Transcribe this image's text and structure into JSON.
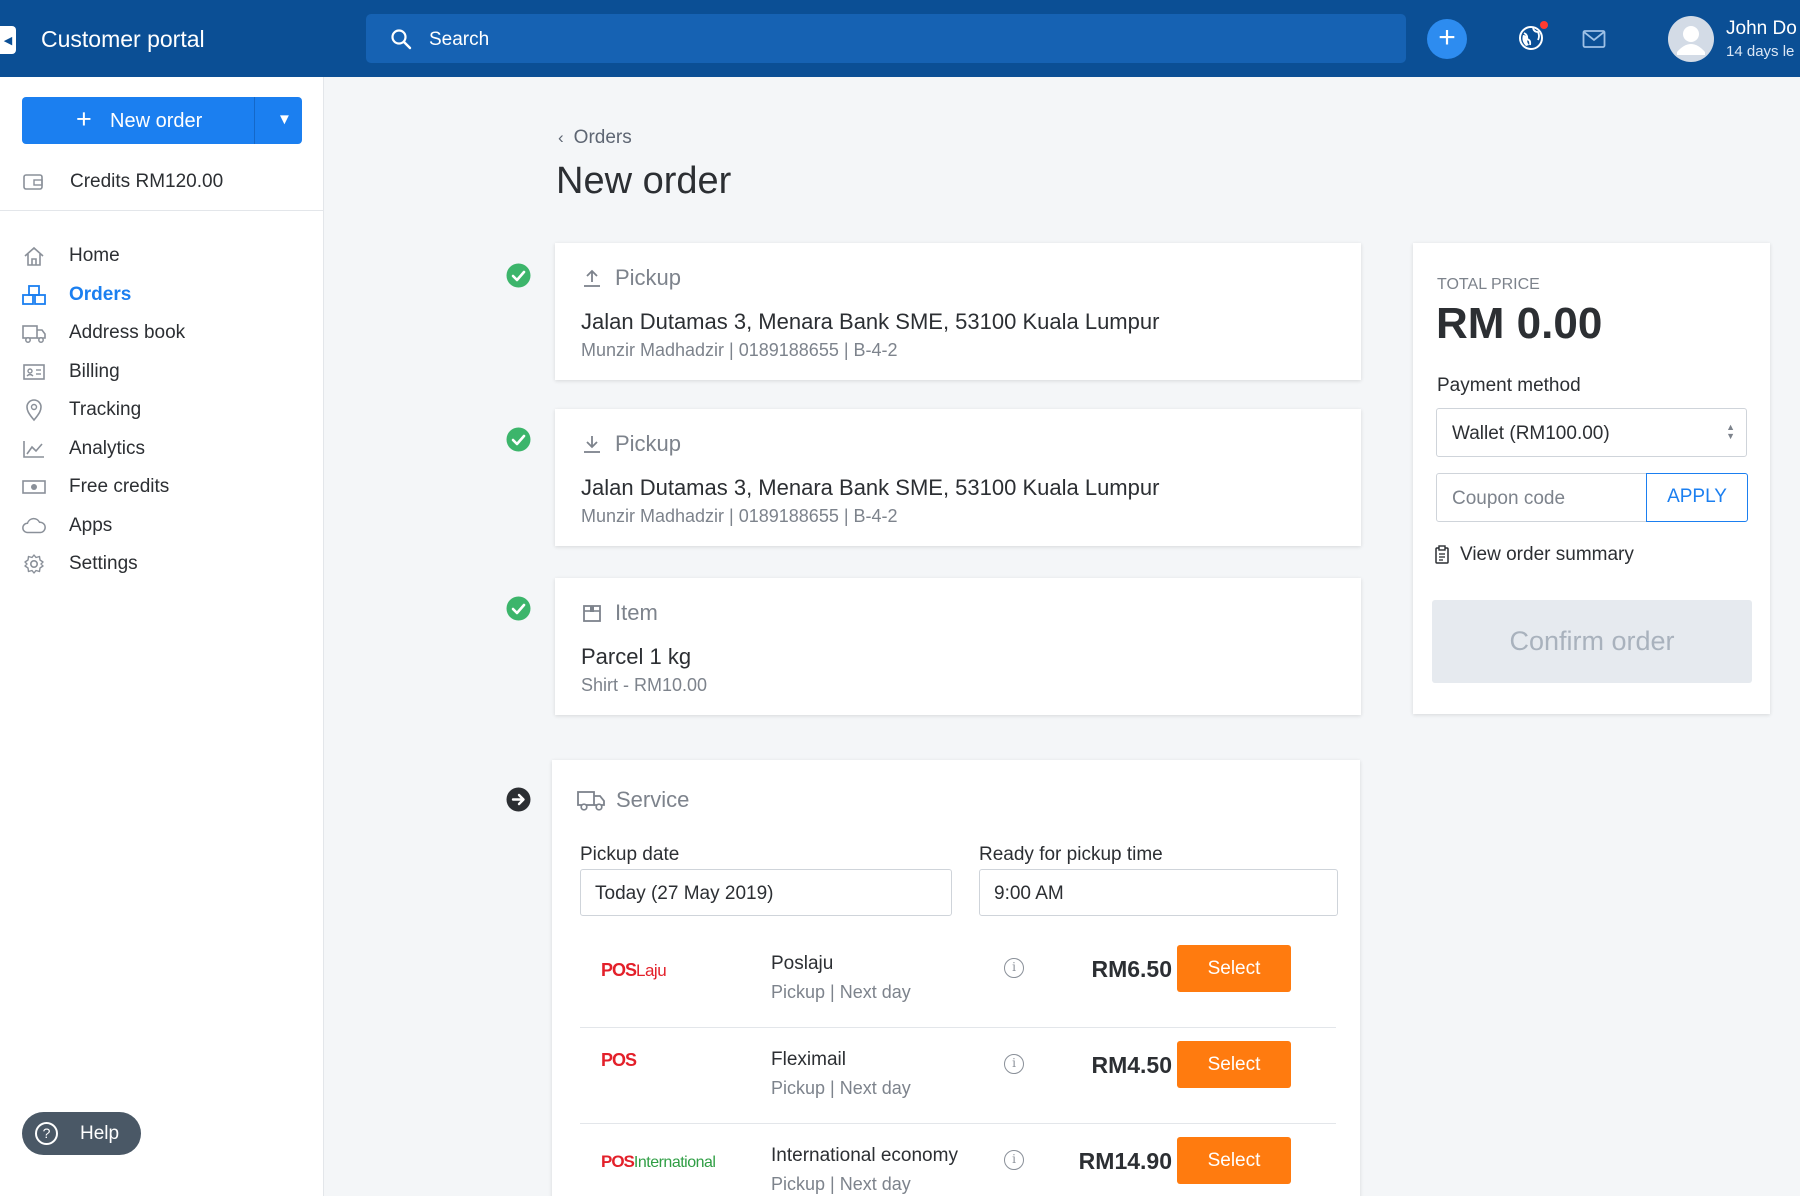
{
  "header": {
    "app_title": "Customer portal",
    "search_placeholder": "Search",
    "user_name": "John Do",
    "user_subtitle": "14 days le"
  },
  "sidebar": {
    "new_order_label": "New order",
    "credits_label": "Credits",
    "credits_value": "RM120.00",
    "items": [
      {
        "label": "Home",
        "icon": "home-icon"
      },
      {
        "label": "Orders",
        "icon": "orders-icon",
        "active": true
      },
      {
        "label": "Address book",
        "icon": "truck-icon"
      },
      {
        "label": "Billing",
        "icon": "billing-icon"
      },
      {
        "label": "Tracking",
        "icon": "location-pin-icon"
      },
      {
        "label": "Analytics",
        "icon": "chart-icon"
      },
      {
        "label": "Free credits",
        "icon": "money-icon"
      },
      {
        "label": "Apps",
        "icon": "cloud-icon"
      },
      {
        "label": "Settings",
        "icon": "gear-icon"
      }
    ],
    "help_label": "Help"
  },
  "main": {
    "breadcrumb": "Orders",
    "title": "New order",
    "pickup": {
      "heading": "Pickup",
      "address": "Jalan Dutamas 3, Menara Bank SME, 53100 Kuala Lumpur",
      "meta": "Munzir Madhadzir | 0189188655 | B-4-2"
    },
    "dropoff": {
      "heading": "Pickup",
      "address": "Jalan Dutamas 3, Menara Bank SME, 53100 Kuala Lumpur",
      "meta": "Munzir Madhadzir | 0189188655 | B-4-2"
    },
    "item": {
      "heading": "Item",
      "name": "Parcel 1 kg",
      "meta": "Shirt - RM10.00"
    },
    "service": {
      "heading": "Service",
      "pickup_date_label": "Pickup date",
      "pickup_date_value": "Today (27 May 2019)",
      "pickup_time_label": "Ready for pickup time",
      "pickup_time_value": "9:00 AM",
      "options": [
        {
          "logo_main": "POS",
          "logo_sub": "Laju",
          "name": "Poslaju",
          "detail": "Pickup | Next day",
          "price": "RM6.50",
          "button": "Select"
        },
        {
          "logo_main": "POS",
          "logo_sub": "",
          "name": "Fleximail",
          "detail": "Pickup | Next day",
          "price": "RM4.50",
          "button": "Select"
        },
        {
          "logo_main": "POS",
          "logo_sub": "International",
          "name": "International economy",
          "detail": "Pickup | Next day",
          "price": "RM14.90",
          "button": "Select"
        }
      ]
    }
  },
  "summary": {
    "total_label": "TOTAL PRICE",
    "total_value": "RM 0.00",
    "payment_label": "Payment method",
    "payment_value": "Wallet (RM100.00)",
    "coupon_placeholder": "Coupon code",
    "apply_label": "APPLY",
    "view_summary_label": "View order summary",
    "confirm_label": "Confirm order"
  },
  "colors": {
    "header_bg": "#0b4f95",
    "primary": "#1b7ff0",
    "select_button": "#ff7b0f",
    "success": "#3cb56b"
  }
}
